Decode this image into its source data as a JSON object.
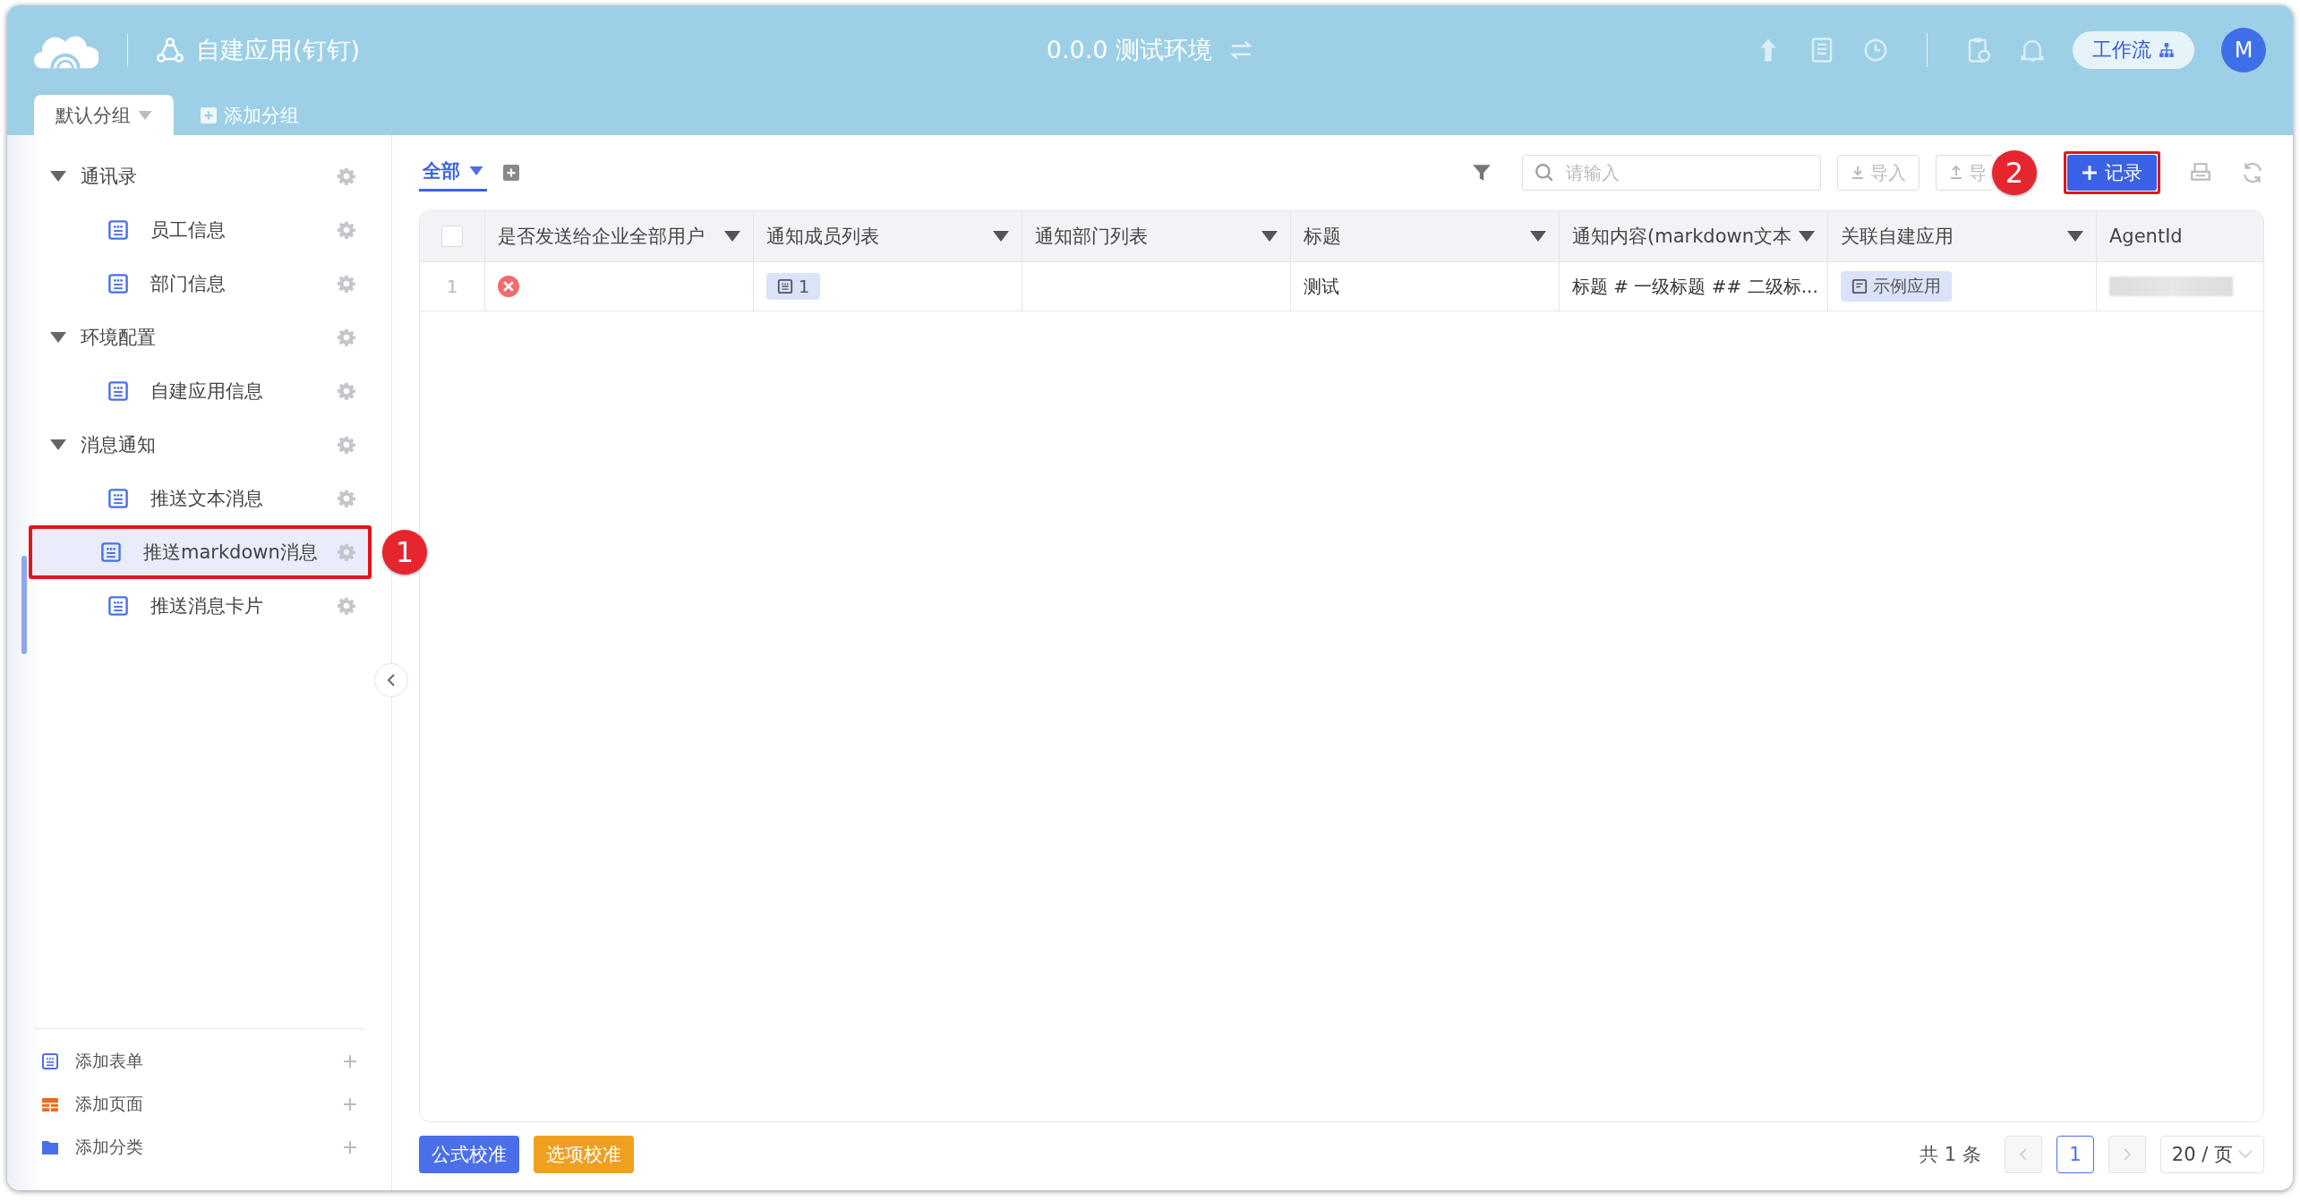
{
  "header": {
    "app_title": "自建应用(钉钉)",
    "environment": "0.0.0 测试环境",
    "workflow_button": "工作流",
    "avatar": "M"
  },
  "group_tabs": [
    {
      "label": "默认分组",
      "selected": true
    }
  ],
  "add_group_button": "添加分组",
  "sidebar": {
    "tree": [
      {
        "label": "通讯录",
        "expanded": true,
        "children": [
          {
            "label": "员工信息",
            "selected": false
          },
          {
            "label": "部门信息",
            "selected": false
          }
        ]
      },
      {
        "label": "环境配置",
        "expanded": true,
        "children": [
          {
            "label": "自建应用信息",
            "selected": false
          }
        ]
      },
      {
        "label": "消息通知",
        "expanded": true,
        "children": [
          {
            "label": "推送文本消息",
            "selected": false
          },
          {
            "label": "推送markdown消息",
            "selected": true
          },
          {
            "label": "推送消息卡片",
            "selected": false
          }
        ]
      }
    ],
    "footer_items": [
      {
        "label": "添加表单",
        "kind": "form"
      },
      {
        "label": "添加页面",
        "kind": "page"
      },
      {
        "label": "添加分类",
        "kind": "folder"
      }
    ]
  },
  "view_tabs": [
    {
      "label": "全部",
      "selected": true
    }
  ],
  "toolbar": {
    "search": {
      "placeholder": "请输入"
    },
    "import_button": "导入",
    "export_button": "导",
    "add_record_button": "记录"
  },
  "table": {
    "select_all_checked": false,
    "columns": [
      {
        "label": "是否发送给企业全部用户",
        "has_menu": true
      },
      {
        "label": "通知成员列表",
        "has_menu": true
      },
      {
        "label": "通知部门列表",
        "has_menu": true
      },
      {
        "label": "标题",
        "has_menu": true
      },
      {
        "label": "通知内容(markdown文本",
        "has_menu": true
      },
      {
        "label": "关联自建应用",
        "has_menu": true
      },
      {
        "label": "AgentId",
        "has_menu": false
      }
    ],
    "rows": [
      {
        "number": "1",
        "send_to_all": false,
        "members": "1",
        "title": "测试",
        "content": "标题 # 一级标题 ## 二级标...",
        "linked_app": "示例应用",
        "agent_id_hidden": true
      }
    ]
  },
  "footer": {
    "formula_button": "公式校准",
    "options_button": "选项校准",
    "total": "共 1 条",
    "pages": [
      {
        "label": "1",
        "selected": true
      }
    ],
    "page_size": "20 / 页"
  },
  "callouts": [
    "1",
    "2"
  ]
}
